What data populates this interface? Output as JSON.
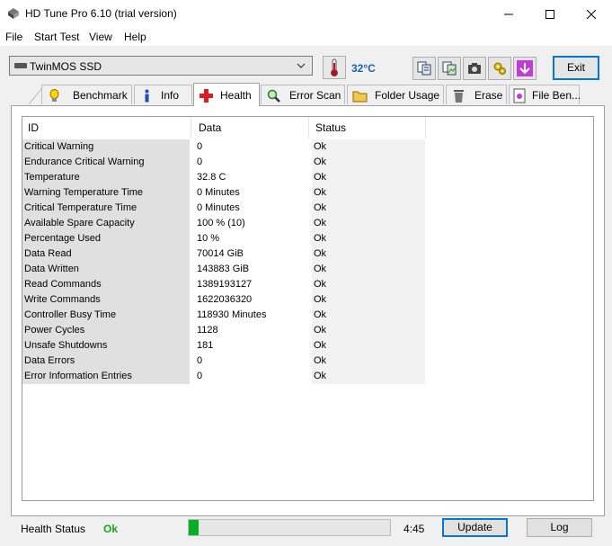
{
  "window": {
    "title": "HD Tune Pro 6.10 (trial version)"
  },
  "menu": [
    "File",
    "Start Test",
    "View",
    "Help"
  ],
  "toolbar": {
    "drive": "TwinMOS SSD",
    "temperature": "32°C",
    "exit_label": "Exit",
    "buttons": [
      "copy-text-icon",
      "copy-screen-icon",
      "camera-icon",
      "settings-icon",
      "download-arrow-icon"
    ]
  },
  "tabs": [
    {
      "label": "Benchmark",
      "icon": "lightbulb-icon"
    },
    {
      "label": "Info",
      "icon": "info-icon"
    },
    {
      "label": "Health",
      "icon": "health-cross-icon",
      "active": true
    },
    {
      "label": "Error Scan",
      "icon": "magnifier-icon"
    },
    {
      "label": "Folder Usage",
      "icon": "folder-icon"
    },
    {
      "label": "Erase",
      "icon": "trash-icon"
    },
    {
      "label": "File Ben...",
      "icon": "file-benchmark-icon"
    }
  ],
  "health_table": {
    "columns": [
      "ID",
      "Data",
      "Status"
    ],
    "rows": [
      {
        "id": "Critical Warning",
        "data": "0",
        "status": "Ok"
      },
      {
        "id": "Endurance Critical Warning",
        "data": "0",
        "status": "Ok"
      },
      {
        "id": "Temperature",
        "data": "32.8 C",
        "status": "Ok"
      },
      {
        "id": "Warning Temperature Time",
        "data": "0 Minutes",
        "status": "Ok"
      },
      {
        "id": "Critical Temperature Time",
        "data": "0 Minutes",
        "status": "Ok"
      },
      {
        "id": "Available Spare Capacity",
        "data": "100 % (10)",
        "status": "Ok"
      },
      {
        "id": "Percentage Used",
        "data": "10 %",
        "status": "Ok"
      },
      {
        "id": "Data Read",
        "data": "70014 GiB",
        "status": "Ok"
      },
      {
        "id": "Data Written",
        "data": "143883 GiB",
        "status": "Ok"
      },
      {
        "id": "Read Commands",
        "data": "1389193127",
        "status": "Ok"
      },
      {
        "id": "Write Commands",
        "data": "1622036320",
        "status": "Ok"
      },
      {
        "id": "Controller Busy Time",
        "data": "118930 Minutes",
        "status": "Ok"
      },
      {
        "id": "Power Cycles",
        "data": "1128",
        "status": "Ok"
      },
      {
        "id": "Unsafe Shutdowns",
        "data": "181",
        "status": "Ok"
      },
      {
        "id": "Data Errors",
        "data": "0",
        "status": "Ok"
      },
      {
        "id": "Error Information Entries",
        "data": "0",
        "status": "Ok"
      }
    ]
  },
  "status_bar": {
    "health_label": "Health Status",
    "health_value": "Ok",
    "health_color": "#16a51a",
    "progress_fraction": 0.05,
    "time": "4:45",
    "update_label": "Update",
    "log_label": "Log"
  }
}
